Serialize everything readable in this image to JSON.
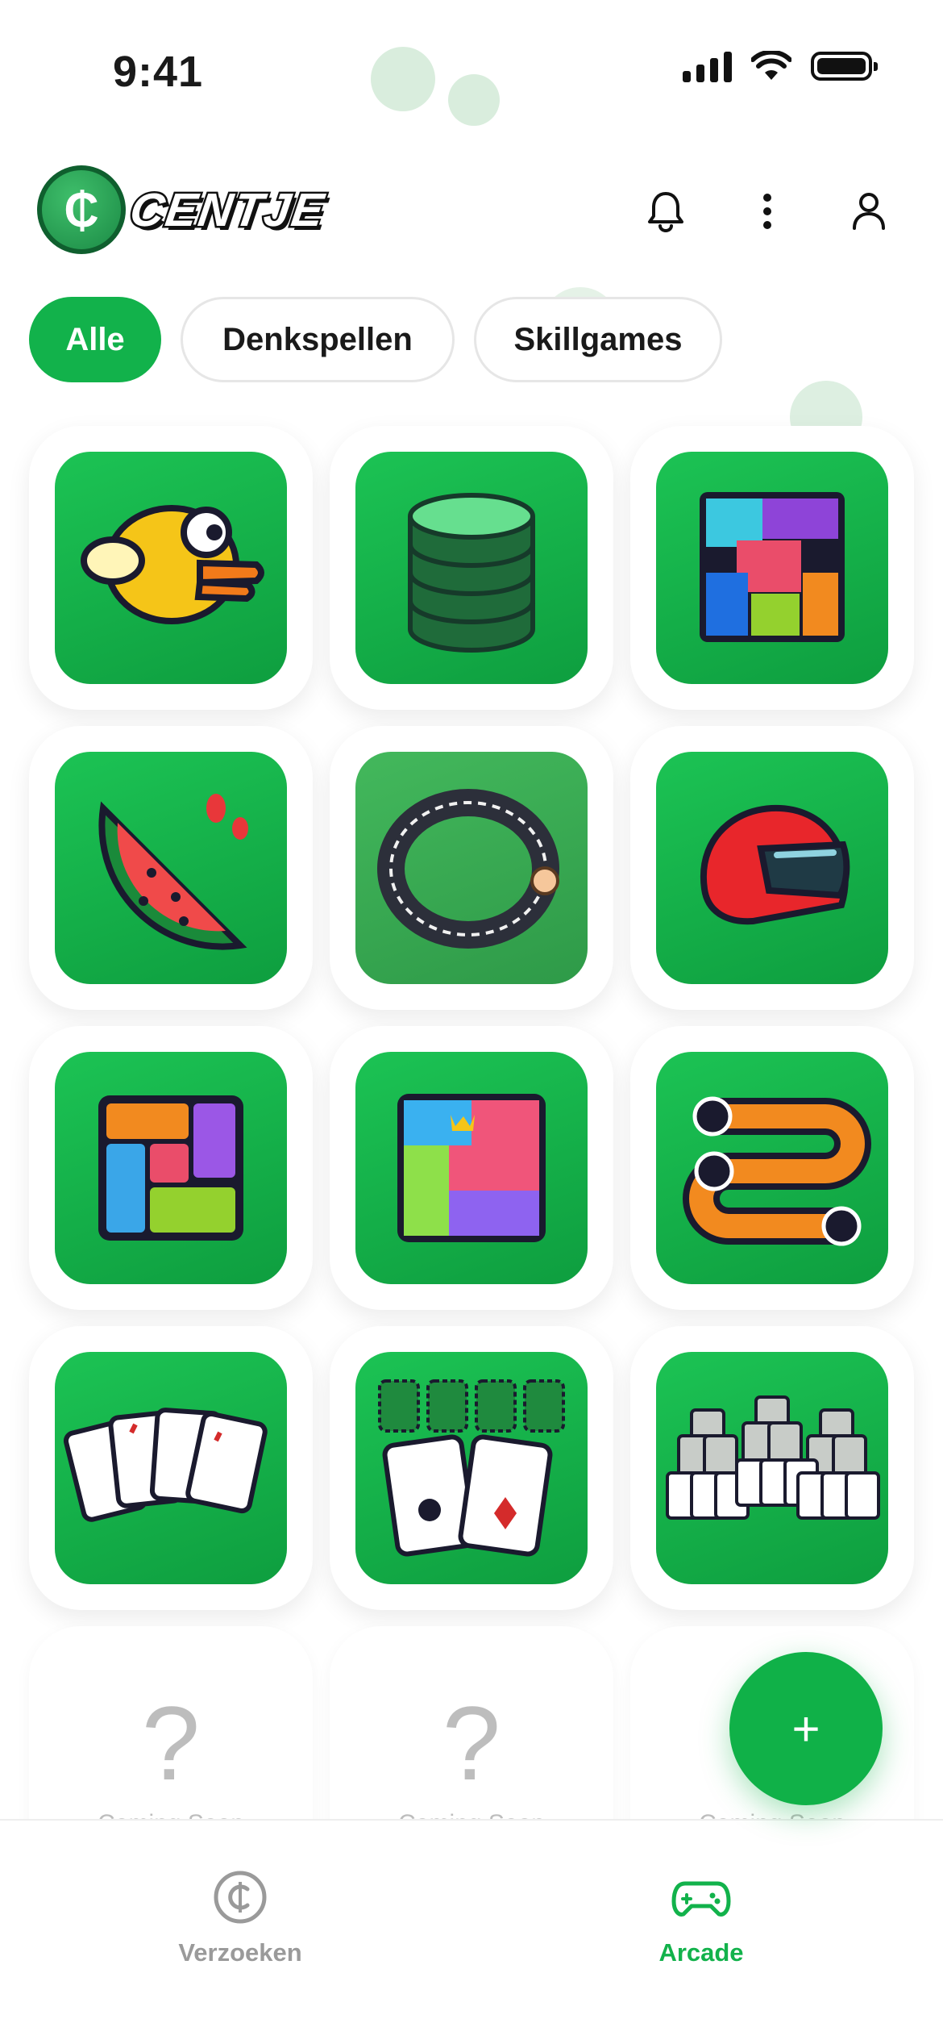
{
  "status_bar": {
    "time": "9:41"
  },
  "header": {
    "brand": "CENTJE",
    "coin_symbol": "₵",
    "icons": [
      "bell-icon",
      "more-vertical-icon",
      "user-icon"
    ]
  },
  "filters": [
    {
      "label": "Alle",
      "active": true
    },
    {
      "label": "Denkspellen",
      "active": false
    },
    {
      "label": "Skillgames",
      "active": false
    }
  ],
  "games": [
    {
      "icon": "flappy-bird-icon"
    },
    {
      "icon": "coin-stack-icon"
    },
    {
      "icon": "block-puzzle-icon"
    },
    {
      "icon": "watermelon-slice-icon"
    },
    {
      "icon": "race-track-icon"
    },
    {
      "icon": "racing-helmet-icon"
    },
    {
      "icon": "sliding-blocks-icon"
    },
    {
      "icon": "queens-puzzle-icon"
    },
    {
      "icon": "number-path-icon"
    },
    {
      "icon": "card-sequence-icon"
    },
    {
      "icon": "solitaire-cards-icon"
    },
    {
      "icon": "tripeaks-solitaire-icon"
    }
  ],
  "placeholders": [
    {
      "symbol": "?",
      "label": "Coming Soon"
    },
    {
      "symbol": "?",
      "label": "Coming Soon"
    },
    {
      "symbol": "?",
      "label": "Coming Soon"
    }
  ],
  "fab": {
    "symbol": "+"
  },
  "bottom_nav": [
    {
      "label": "Verzoeken",
      "icon": "coin-outline-icon",
      "active": false
    },
    {
      "label": "Arcade",
      "icon": "gamepad-icon",
      "active": true
    }
  ],
  "colors": {
    "accent": "#12b24b",
    "inactive": "#9a9a9a"
  }
}
